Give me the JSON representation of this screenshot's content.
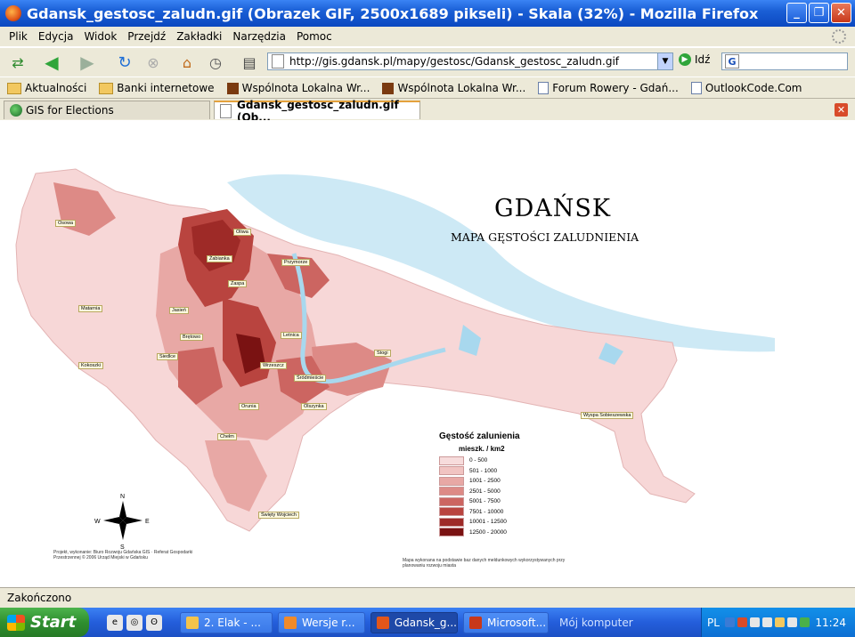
{
  "window": {
    "title": "Gdansk_gestosc_zaludn.gif (Obrazek GIF, 2500x1689 pikseli) - Skala (32%) - Mozilla Firefox",
    "minimize": "_",
    "maximize": "❐",
    "close": "✕"
  },
  "menu": [
    "Plik",
    "Edycja",
    "Widok",
    "Przejdź",
    "Zakładki",
    "Narzędzia",
    "Pomoc"
  ],
  "nav": {
    "url": "http://gis.gdansk.pl/mapy/gestosc/Gdansk_gestosc_zaludn.gif",
    "go_label": "Idź",
    "search_logo": "G"
  },
  "bookmarks": [
    {
      "label": "Aktualności",
      "icon": "folder"
    },
    {
      "label": "Banki internetowe",
      "icon": "folder"
    },
    {
      "label": "Wspólnota Lokalna Wr...",
      "icon": "wl"
    },
    {
      "label": "Wspólnota Lokalna Wr...",
      "icon": "wl"
    },
    {
      "label": "Forum Rowery - Gdań...",
      "icon": "page"
    },
    {
      "label": "OutlookCode.Com",
      "icon": "page"
    }
  ],
  "tabs": [
    {
      "label": "GIS for Elections"
    },
    {
      "label": "Gdansk_gestosc_zaludn.gif (Ob..."
    }
  ],
  "map": {
    "title": "GDAŃSK",
    "subtitle": "MAPA GĘSTOŚCI ZALUDNIENIA",
    "legend_title": "Gęstość zalunienia",
    "legend_unit": "mieszk. / km2",
    "legend": [
      {
        "label": "0 - 500",
        "color": "#f7dcdc"
      },
      {
        "label": "501 - 1000",
        "color": "#f1c4c2"
      },
      {
        "label": "1001 - 2500",
        "color": "#e8a8a5"
      },
      {
        "label": "2501 - 5000",
        "color": "#dd8a86"
      },
      {
        "label": "5001 - 7500",
        "color": "#cc6561"
      },
      {
        "label": "7501 - 10000",
        "color": "#b9443f"
      },
      {
        "label": "10001 - 12500",
        "color": "#9e2a27"
      },
      {
        "label": "12500 - 20000",
        "color": "#7a1212"
      }
    ],
    "districts": [
      "Osowa",
      "Matarnia",
      "Brętowo",
      "Kokoszki",
      "Oliwa",
      "Żabianka",
      "Przymorze",
      "Zaspa",
      "Wrzeszcz",
      "Stogi",
      "Śródmieście",
      "Orunia",
      "Chełm",
      "Siedlce",
      "Wyspa Sobieszewska",
      "Olszynka",
      "Święty Wojciech",
      "Letnica",
      "Jasień"
    ],
    "compass": {
      "n": "N",
      "e": "E",
      "s": "S",
      "w": "W"
    },
    "credit_left": "Projekt, wykonanie: Biuro Rozwoju Gdańska GIS · Referat Gospodarki Przestrzennej © 2006 Urząd Miejski w Gdańsku",
    "credit_right": "Mapa wykonana na podstawie baz danych meldunkowych wykorzystywanych przy planowaniu rozwoju miasta"
  },
  "status": "Zakończono",
  "taskbar": {
    "start": "Start",
    "items": [
      {
        "label": "2. Elak - ...",
        "state": "norm",
        "icon_color": "#f4c34a"
      },
      {
        "label": "Wersje r...",
        "state": "norm",
        "icon_color": "#f08a2a"
      },
      {
        "label": "Gdansk_g...",
        "state": "active",
        "icon_color": "#e2561a"
      },
      {
        "label": "Microsoft...",
        "state": "norm",
        "icon_color": "#c8381a"
      },
      {
        "label": "Mój komputer",
        "state": "desk",
        "icon_color": ""
      }
    ],
    "lang": "PL",
    "clock": "11:24"
  }
}
